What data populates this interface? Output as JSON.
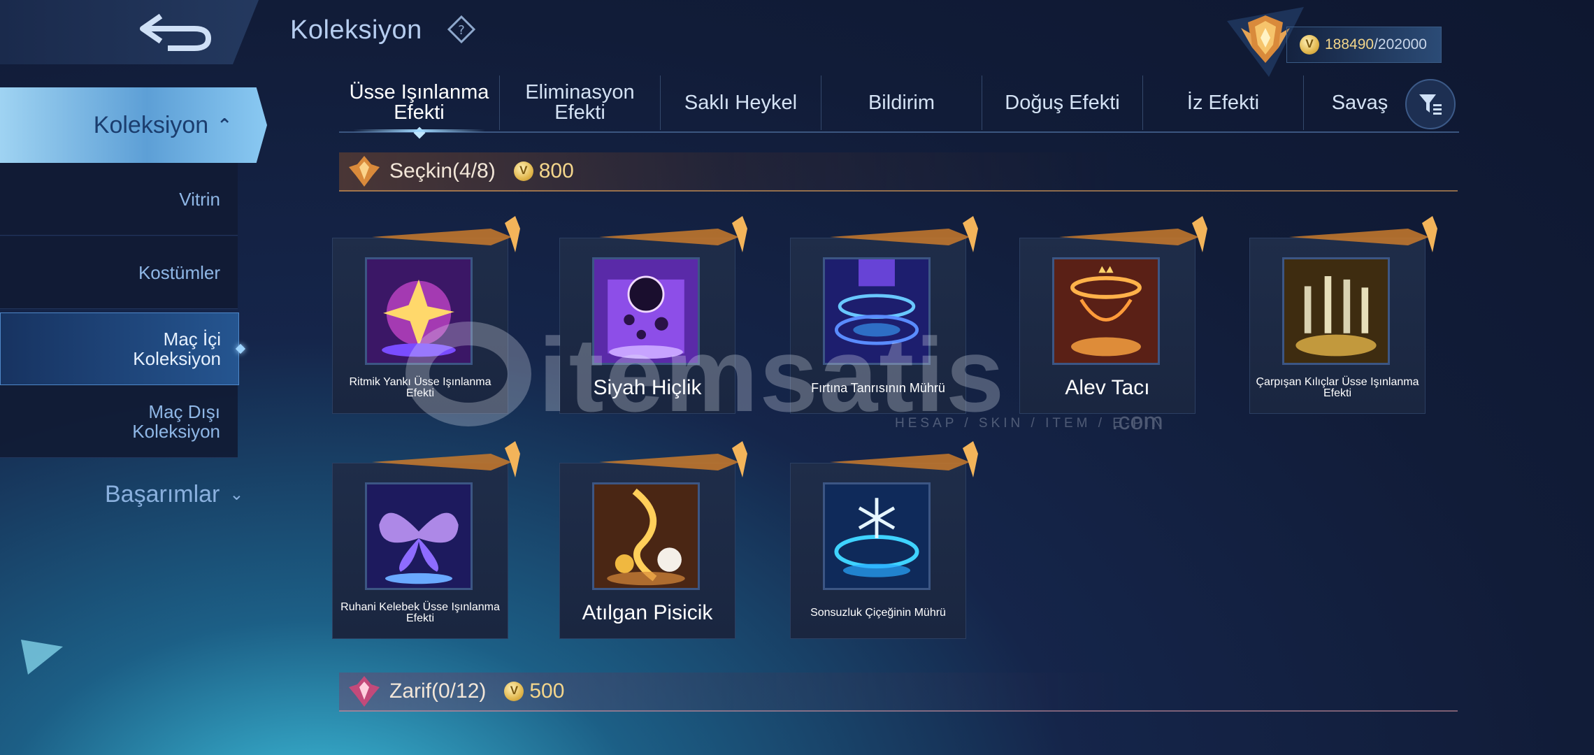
{
  "header": {
    "title": "Koleksiyon",
    "currency_current": "188490",
    "currency_max": "/202000"
  },
  "sidebar": {
    "active_group": "Koleksiyon",
    "items": [
      {
        "label": "Vitrin"
      },
      {
        "label": "Kostümler"
      },
      {
        "label": "Maç İçi Koleksiyon",
        "line1": "Maç İçi",
        "line2": "Koleksiyon"
      },
      {
        "label": "Maç Dışı Koleksiyon",
        "line1": "Maç Dışı",
        "line2": "Koleksiyon"
      }
    ],
    "group2": "Başarımlar"
  },
  "tabs": [
    {
      "line1": "Üsse Işınlanma",
      "line2": "Efekti"
    },
    {
      "line1": "Eliminasyon",
      "line2": "Efekti"
    },
    {
      "line1": "Saklı Heykel",
      "line2": ""
    },
    {
      "line1": "Bildirim",
      "line2": ""
    },
    {
      "line1": "Doğuş Efekti",
      "line2": ""
    },
    {
      "line1": "İz Efekti",
      "line2": ""
    },
    {
      "line1": "Savaş",
      "line2": ""
    }
  ],
  "sections": [
    {
      "title": "Seçkin(4/8)",
      "price": "800"
    },
    {
      "title": "Zarif(0/12)",
      "price": "500"
    }
  ],
  "items": [
    {
      "name": "Ritmik Yankı Üsse Işınlanma Efekti"
    },
    {
      "name": "Siyah Hiçlik"
    },
    {
      "name": "Fırtına Tanrısının Mührü"
    },
    {
      "name": "Alev Tacı"
    },
    {
      "name": "Çarpışan Kılıçlar Üsse Işınlanma Efekti"
    },
    {
      "name": "Ruhani Kelebek Üsse Işınlanma Efekti"
    },
    {
      "name": "Atılgan Pisicik"
    },
    {
      "name": "Sonsuzluk Çiçeğinin Mührü"
    }
  ],
  "watermark": {
    "brand": "itemsatis",
    "tagline": "HESAP / SKIN / ITEM / E-PIN",
    "suffix": ".com"
  },
  "icons": {
    "back": "back-arrow-icon",
    "help": "question-diamond-icon",
    "rank": "rank-emblem-icon",
    "filter": "filter-icon",
    "currency": "coin-icon"
  },
  "colors": {
    "accent_blue": "#8ac9f2",
    "gold": "#f4d68c",
    "background": "#111c38"
  }
}
